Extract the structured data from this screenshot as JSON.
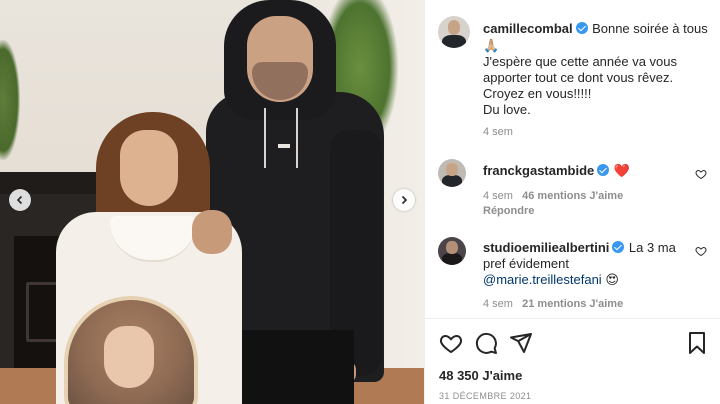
{
  "caption": {
    "username": "camillecombal",
    "lines": [
      "Bonne soirée à tous",
      "🙏🏼",
      "J'espère que cette année va vous",
      "apporter tout ce dont vous rêvez.",
      "Croyez en vous!!!!!",
      "Du love."
    ],
    "time": "4 sem"
  },
  "comments": [
    {
      "username": "franckgastambide",
      "text": "❤️",
      "time": "4 sem",
      "likes": "46 mentions J'aime",
      "reply": "Répondre"
    },
    {
      "username": "studioemiliealbertini",
      "text_line1": "La 3 ma",
      "text_line2": "pref évidement",
      "mention": "@marie.treillestefani",
      "emoji": "😍",
      "time": "4 sem",
      "likes": "21 mentions J'aime"
    }
  ],
  "footer": {
    "likes": "48 350 J'aime",
    "date": "31 DÉCEMBRE 2021"
  },
  "icons": {
    "like": "heart-icon",
    "comment": "comment-icon",
    "share": "share-icon",
    "save": "bookmark-icon",
    "prev": "chevron-left-icon",
    "next": "chevron-right-icon"
  },
  "colors": {
    "verified": "#3897f0",
    "mention": "#00376b",
    "muted": "#8e8e8e"
  }
}
